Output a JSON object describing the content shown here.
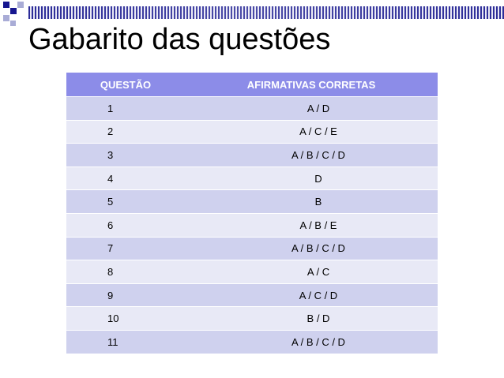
{
  "title": "Gabarito das questões",
  "colors": {
    "header_bg": "#8c8ce8",
    "row_odd": "#cfd1ee",
    "row_even": "#e8e9f6",
    "deco_blue": "#16168f",
    "deco_light": "#a9acd6"
  },
  "table": {
    "headers": [
      "QUESTÃO",
      "AFIRMATIVAS CORRETAS"
    ],
    "rows": [
      [
        "1",
        "A / D"
      ],
      [
        "2",
        "A / C / E"
      ],
      [
        "3",
        "A / B / C / D"
      ],
      [
        "4",
        "D"
      ],
      [
        "5",
        "B"
      ],
      [
        "6",
        "A / B / E"
      ],
      [
        "7",
        "A / B / C / D"
      ],
      [
        "8",
        "A / C"
      ],
      [
        "9",
        "A / C / D"
      ],
      [
        "10",
        "B / D"
      ],
      [
        "11",
        "A / B / C / D"
      ]
    ]
  }
}
